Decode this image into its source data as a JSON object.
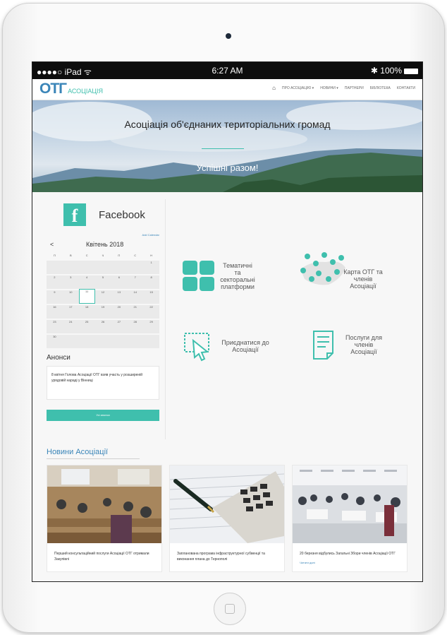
{
  "status_bar": {
    "carrier": "●●●●○ iPad ᯤ",
    "time": "6:27 AM",
    "battery": "✱ 100%"
  },
  "logo": {
    "main": "ОТГ",
    "sub": "АСОЦІАЦІЯ"
  },
  "menu": {
    "home_icon": "home-icon",
    "items": [
      "ПРО АСОЦІАЦІЮ ▾",
      "НОВИНИ ▾",
      "ПАРТНЕРИ",
      "БІБЛІОТЕКА",
      "КОНТАКТИ"
    ]
  },
  "hero": {
    "title": "Асоціація об'єднаних територіальних громад",
    "tagline": "Успішні разом!"
  },
  "sidebar": {
    "facebook_label": "Facebook",
    "widget_link": "Add Calendar",
    "calendar": {
      "prev": "<",
      "month": "Квітень 2018",
      "dow": [
        "П",
        "В",
        "С",
        "Ч",
        "П",
        "С",
        "Н"
      ],
      "rows": [
        [
          "",
          "",
          "",
          "",
          "",
          "",
          "1"
        ],
        [
          "2",
          "3",
          "4",
          "5",
          "6",
          "7",
          "8"
        ],
        [
          "9",
          "10",
          "11",
          "12",
          "13",
          "14",
          "15"
        ],
        [
          "16",
          "17",
          "18",
          "19",
          "20",
          "21",
          "22"
        ],
        [
          "23",
          "24",
          "25",
          "26",
          "27",
          "28",
          "29"
        ],
        [
          "30",
          "",
          "",
          "",
          "",
          "",
          ""
        ]
      ]
    },
    "announcements_title": "Анонси",
    "announcement_text": "8 квітня Голова Асоціації ОТГ взяв участь у розширеній урядовій нараді у Вінниці",
    "all_button": "Усі анонси"
  },
  "features": [
    {
      "label": "Тематичні та секторальні платформи",
      "icon": "grid-icon"
    },
    {
      "label": "Карта ОТГ та членів Асоціації",
      "icon": "map-pins-icon"
    },
    {
      "label": "Приєднатися до Асоціації",
      "icon": "cursor-icon"
    },
    {
      "label": "Послуги для членів Асоціації",
      "icon": "document-icon"
    }
  ],
  "news": {
    "title": "Новини Асоціації",
    "cards": [
      {
        "caption": "Перший консультаційний послуги Асоціації ОТГ отримали Закупівлі",
        "more": ""
      },
      {
        "caption": "Запланована програма інфраструктурної субвенції та виконання плана до Тернополі",
        "more": ""
      },
      {
        "caption": "20 березня відбулись Загальні Збори членів Асоціації ОТГ",
        "more": "Читати далі"
      }
    ]
  },
  "colors": {
    "accent": "#3fbfad",
    "brand": "#3a85b8"
  }
}
